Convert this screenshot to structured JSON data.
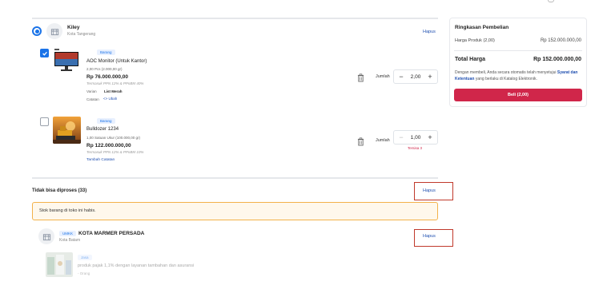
{
  "seller_active": {
    "name": "Kiley",
    "city": "Kota Tangerang",
    "delete_label": "Hapus"
  },
  "items": [
    {
      "badge": "Barang",
      "name": "AOC Monitor (Untuk Kantor)",
      "qty_info": "2,00 Pcs (2.000,00 gr)",
      "price": "Rp 76.000.000,00",
      "tax": "Termasuk PPN 12% & PPnBM 40%",
      "variant_label": "Varian",
      "variant_value": "List Merah",
      "note_label": "Catatan",
      "note_value": "<> Ubah",
      "qty_label": "Jumlah",
      "qty_value": "2,00"
    },
    {
      "badge": "Barang",
      "name": "Bulldozer 1234",
      "qty_info": "1,00 Satuan Ukur (100.000,00 gr)",
      "price": "Rp 122.000.000,00",
      "tax": "Termasuk PPN 12% & PPnBM 10%",
      "add_note": "Tambah Catatan",
      "qty_label": "Jumlah",
      "qty_value": "1,00",
      "remaining": "Tersisa 3"
    }
  ],
  "summary": {
    "title": "Ringkasan Pembelian",
    "product_price_label": "Harga Produk (2,00)",
    "product_price_value": "Rp 152.000.000,00",
    "total_label": "Total Harga",
    "total_value": "Rp 152.000.000,00",
    "consent_prefix": "Dengan membeli, Anda secara otomatis telah menyetujui ",
    "consent_link": "Syarat dan Ketentuan",
    "consent_suffix": " yang berlaku di Katalog Elektronik.",
    "buy_label": "Beli (2,00)"
  },
  "unprocessable": {
    "title": "Tidak bisa diproses (33)",
    "delete_label": "Hapus",
    "warning": "Stok barang di toko ini habis.",
    "seller_tag": "UMKK",
    "seller_name": "KOTA MARMER PERSADA",
    "seller_city": "Kota Batam",
    "seller_delete_label": "Hapus",
    "product_tag": "Jasa",
    "product_name": "produk pajak 1,1% dengan layanan tambahan dan asuransi",
    "product_unit": "- Orang"
  },
  "colors": {
    "primary_blue": "#1a73e8",
    "buy_button": "#d0264a",
    "warning_border": "#f3b24a"
  }
}
